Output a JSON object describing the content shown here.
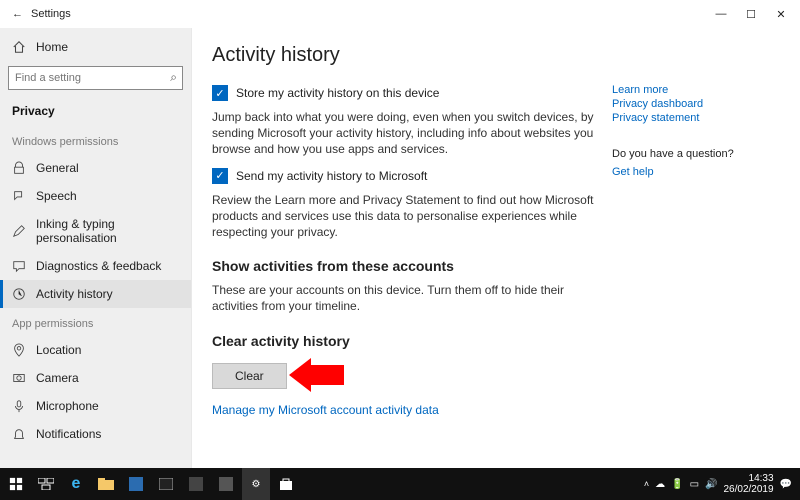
{
  "window": {
    "app_title": "Settings",
    "minimize": "—",
    "maximize": "☐",
    "close": "✕"
  },
  "sidebar": {
    "home": "Home",
    "search_placeholder": "Find a setting",
    "section_title": "Privacy",
    "group_windows": "Windows permissions",
    "group_app": "App permissions",
    "items_win": [
      {
        "label": "General"
      },
      {
        "label": "Speech"
      },
      {
        "label": "Inking & typing personalisation"
      },
      {
        "label": "Diagnostics & feedback"
      },
      {
        "label": "Activity history"
      }
    ],
    "items_app": [
      {
        "label": "Location"
      },
      {
        "label": "Camera"
      },
      {
        "label": "Microphone"
      },
      {
        "label": "Notifications"
      }
    ]
  },
  "main": {
    "title": "Activity history",
    "chk1": "Store my activity history on this device",
    "para1": "Jump back into what you were doing, even when you switch devices, by sending Microsoft your activity history, including info about websites you browse and how you use apps and services.",
    "chk2": "Send my activity history to Microsoft",
    "para2": "Review the Learn more and Privacy Statement to find out how Microsoft products and services use this data to personalise experiences while respecting your privacy.",
    "accounts_title": "Show activities from these accounts",
    "accounts_para": "These are your accounts on this device. Turn them off to hide their activities from your timeline.",
    "clear_title": "Clear activity history",
    "clear_button": "Clear",
    "manage_link": "Manage my Microsoft account activity data"
  },
  "right": {
    "learn_more": "Learn more",
    "dashboard": "Privacy dashboard",
    "statement": "Privacy statement",
    "question": "Do you have a question?",
    "get_help": "Get help"
  },
  "taskbar": {
    "time": "14:33",
    "date": "26/02/2019"
  }
}
